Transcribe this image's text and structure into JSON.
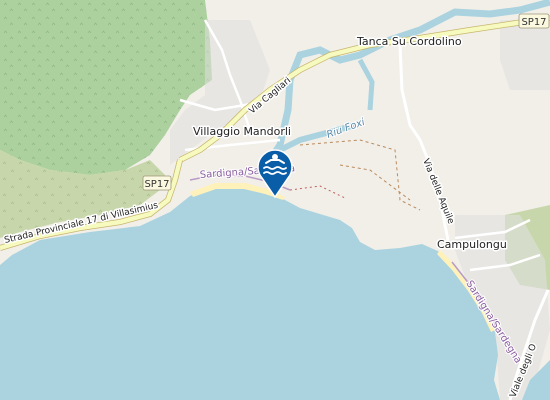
{
  "map": {
    "places": {
      "tanca": "Tanca Su Cordolino",
      "villaggio": "Villaggio Mandorli",
      "campulongu": "Campulongu"
    },
    "roads": {
      "sp17_a": "SP17",
      "sp17_b": "SP17",
      "strada": "Strada Provinciale 17 di Villasimius",
      "cagliari": "Via Cagliari",
      "aquile": "Via delle Aquile",
      "viale": "Viale degli O"
    },
    "waterways": {
      "riu_foxi": "Riu Foxi"
    },
    "routes": {
      "sardigna_top": "Sardigna/Sardegna",
      "sardigna_right": "Sardigna/Sardegna"
    },
    "marker": {
      "icon": "swimming-icon",
      "color": "#0a5ea8"
    },
    "colors": {
      "sea": "#aad3df",
      "forest": "#add19e",
      "land": "#f2efe9",
      "road_primary": "#f7fabf",
      "beach": "#fff1ba",
      "river": "#aad3df"
    }
  }
}
